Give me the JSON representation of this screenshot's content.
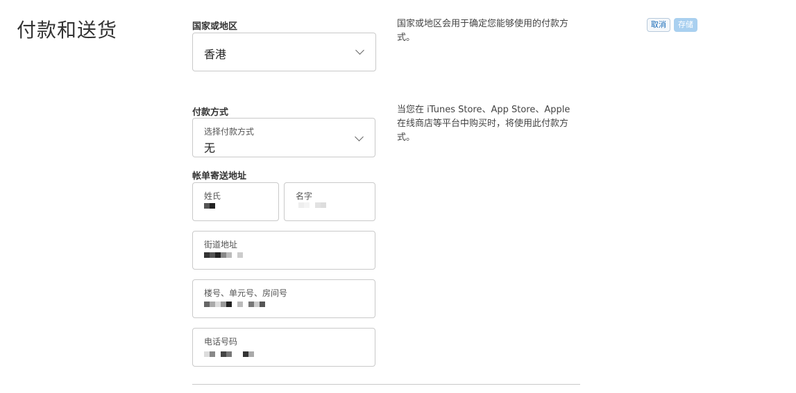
{
  "page": {
    "title": "付款和送货"
  },
  "actions": {
    "cancel_label": "取消",
    "save_label": "存储"
  },
  "country": {
    "section_label": "国家或地区",
    "value": "香港",
    "help": "国家或地区会用于确定您能够使用的付款方式。"
  },
  "payment": {
    "section_label": "付款方式",
    "field_label": "选择付款方式",
    "value": "无",
    "help": "当您在 iTunes Store、App Store、Apple 在线商店等平台中购买时，将使用此付款方式。"
  },
  "billing": {
    "section_label": "帐单寄送地址",
    "last_name_label": "姓氏",
    "first_name_label": "名字",
    "street_label": "街道地址",
    "building_label": "楼号、单元号、房间号",
    "phone_label": "电话号码"
  },
  "icons": {
    "dropdown": "chevron-down-icon"
  }
}
